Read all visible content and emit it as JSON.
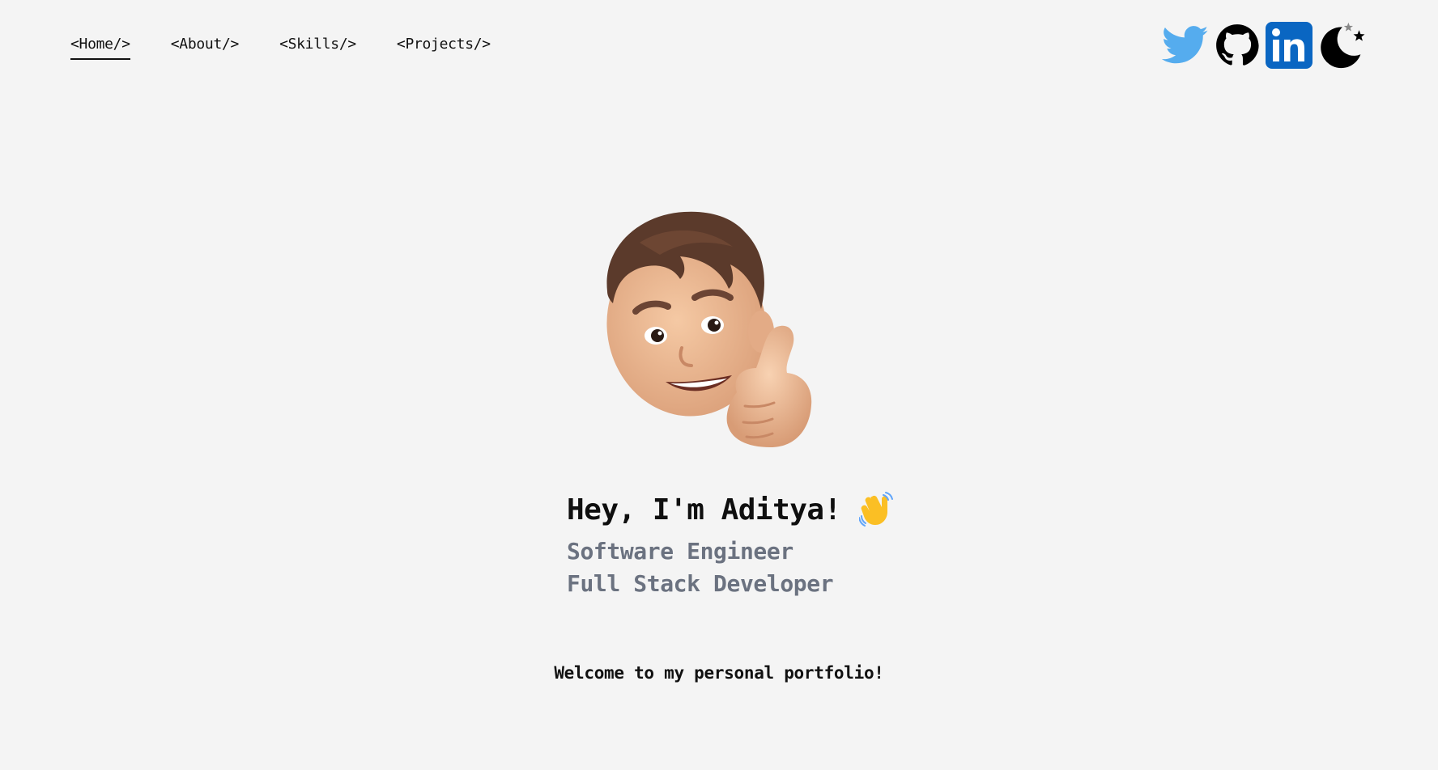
{
  "nav": {
    "items": [
      {
        "label": "<Home/>",
        "active": true
      },
      {
        "label": "<About/>",
        "active": false
      },
      {
        "label": "<Skills/>",
        "active": false
      },
      {
        "label": "<Projects/>",
        "active": false
      }
    ]
  },
  "social": {
    "icons": [
      "twitter-icon",
      "github-icon",
      "linkedin-icon",
      "dark-mode-moon-icon"
    ],
    "colors": {
      "twitter": "#55acee",
      "github": "#000000",
      "linkedin": "#0a66c2"
    }
  },
  "hero": {
    "greeting": "Hey, I'm Aditya!",
    "wave_icon": "waving-hand-icon",
    "roles": [
      "Software Engineer",
      "Full Stack Developer"
    ],
    "avatar_icon": "memoji-thumbs-up-avatar"
  },
  "welcome": "Welcome to my personal portfolio!",
  "theme": {
    "background": "#f4f4f4",
    "text": "#111111",
    "muted": "#6b7280"
  }
}
